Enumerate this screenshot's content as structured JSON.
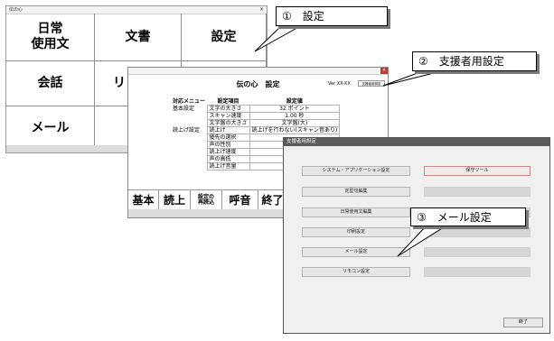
{
  "main_window": {
    "title": "伝の心",
    "close": "×",
    "cells": [
      "日常\n使用文",
      "文書",
      "設定",
      "会話",
      "リ",
      "メール"
    ]
  },
  "settings_window": {
    "close": "×",
    "title": "伝の心　設定",
    "version": "Ver XX-XX",
    "supporter_button": "支援者用設定",
    "headers": [
      "対応メニュー",
      "設定項目",
      "設定値"
    ],
    "rows": [
      [
        "基本設定",
        "文字の大きさ",
        "32 ポイント"
      ],
      [
        "",
        "スキャン速度",
        "1.00 秒"
      ],
      [
        "",
        "文字盤の大きさ",
        "文字盤(大)"
      ],
      [
        "読上げ設定",
        "読上げ",
        "読上げを行わない(スキャン音あり)"
      ],
      [
        "",
        "優先の選択",
        ""
      ],
      [
        "",
        "声の性別",
        ""
      ],
      [
        "",
        "読上げ速度",
        ""
      ],
      [
        "",
        "声の高低",
        ""
      ],
      [
        "",
        "読上げ音量",
        ""
      ]
    ],
    "bottom_buttons": [
      "基本",
      "読上",
      "設定の\n再読込",
      "呼音",
      "終了"
    ]
  },
  "supporter_window": {
    "title": "支援者用設定",
    "left_buttons": [
      "システム・アプリケーション設定",
      "定型句編集",
      "日常使用文編集",
      "印刷設定",
      "メール設定",
      "リモコン設定"
    ],
    "right_buttons": [
      "保守ツール",
      "",
      "",
      "",
      "",
      ""
    ],
    "close_button": "終了"
  },
  "callouts": [
    "①　設定",
    "②　支援者用設定",
    "③　メール設定"
  ]
}
